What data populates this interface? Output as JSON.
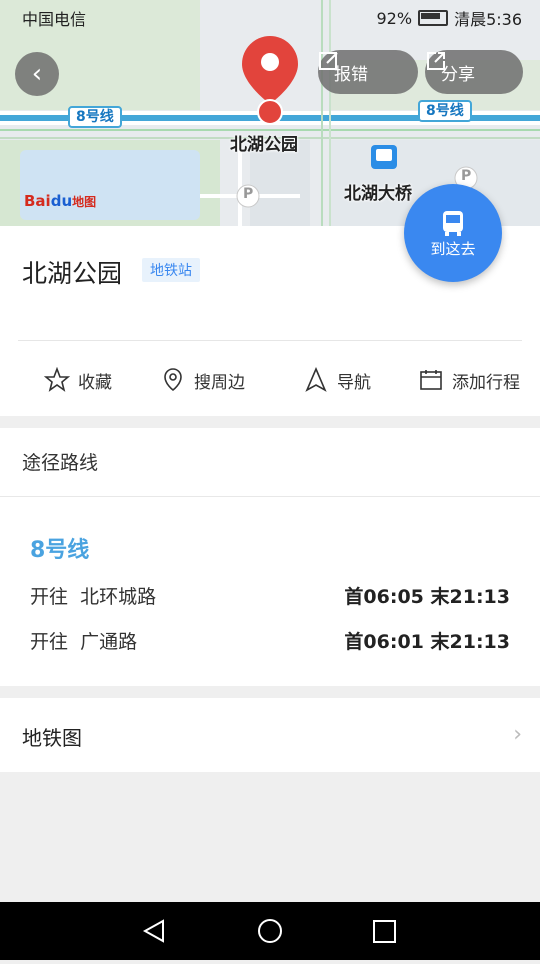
{
  "status_bar": {
    "carrier": "中国电信",
    "battery": "92%",
    "time": "清晨5:36"
  },
  "map": {
    "report_label": "报错",
    "share_label": "分享",
    "line_tag_left": "8号线",
    "line_tag_right": "8号线",
    "pin_label": "北湖公园",
    "station_label": "北湖大桥",
    "logo_bai": "Bai",
    "logo_du": "du",
    "logo_map": "地图",
    "parking_1": "P",
    "parking_2": "P"
  },
  "go_button": {
    "label": "到这去"
  },
  "place": {
    "name": "北湖公园",
    "type_badge": "地铁站"
  },
  "actions": {
    "favorite": "收藏",
    "nearby": "搜周边",
    "navigate": "导航",
    "add_trip": "添加行程"
  },
  "route": {
    "title": "途径路线",
    "line_name": "8号线",
    "directions": [
      {
        "prefix": "开往",
        "destination": "北环城路",
        "times": "首06:05 末21:13"
      },
      {
        "prefix": "开往",
        "destination": "广通路",
        "times": "首06:01 末21:13"
      }
    ]
  },
  "subway_map": {
    "label": "地铁图"
  },
  "colors": {
    "accent": "#3a88f0",
    "line_color": "#4aa3e0",
    "pin_red": "#e2443c"
  }
}
